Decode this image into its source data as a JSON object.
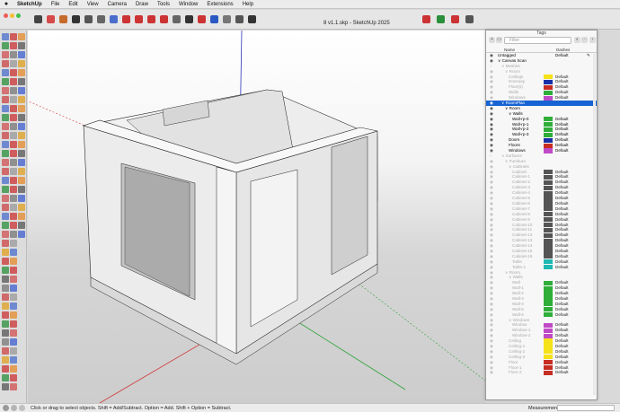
{
  "menubar": {
    "apple": "",
    "items": [
      "SketchUp",
      "File",
      "Edit",
      "View",
      "Camera",
      "Draw",
      "Tools",
      "Window",
      "Extensions",
      "Help"
    ]
  },
  "window": {
    "title": "8 v1.1.skp - SketchUp 2025"
  },
  "status": {
    "hint": "Click or drag to select objects. Shift = Add/Subtract. Option = Add. Shift + Option = Subtract.",
    "measurements_label": "Measurements",
    "measurements_value": ""
  },
  "tags_panel": {
    "header": "Tags",
    "search_placeholder": "Filter",
    "col_name": "Name",
    "col_dashes": "Dashes",
    "rows": [
      {
        "label": "Untagged",
        "indent": 0,
        "dash": "Default",
        "swatch": "",
        "visible": true,
        "dim": false,
        "selected": false,
        "pencil": true
      },
      {
        "label": "Canvas Scan",
        "indent": 0,
        "dash": "",
        "swatch": "",
        "visible": true,
        "dim": false,
        "selected": false,
        "arrow": "∨"
      },
      {
        "label": "Meshes",
        "indent": 1,
        "dash": "",
        "swatch": "",
        "visible": false,
        "dim": true,
        "selected": false,
        "arrow": "∨"
      },
      {
        "label": "Room",
        "indent": 2,
        "dash": "",
        "swatch": "",
        "visible": true,
        "dim": true,
        "selected": false,
        "arrow": "∨"
      },
      {
        "label": "Ceilings",
        "indent": 3,
        "dash": "Default",
        "swatch": "#f5e21a",
        "visible": true,
        "dim": true,
        "selected": false
      },
      {
        "label": "Doorway",
        "indent": 3,
        "dash": "Default",
        "swatch": "#1730a8",
        "visible": true,
        "dim": true,
        "selected": false
      },
      {
        "label": "Floor(s)",
        "indent": 3,
        "dash": "Default",
        "swatch": "#c62d23",
        "visible": true,
        "dim": true,
        "selected": false
      },
      {
        "label": "Walls",
        "indent": 3,
        "dash": "Default",
        "swatch": "#2fae3a",
        "visible": true,
        "dim": true,
        "selected": false
      },
      {
        "label": "Windows",
        "indent": 3,
        "dash": "Default",
        "swatch": "#c04ac7",
        "visible": true,
        "dim": true,
        "selected": false
      },
      {
        "label": "RoomPlan",
        "indent": 1,
        "dash": "",
        "swatch": "",
        "visible": true,
        "dim": false,
        "selected": true,
        "arrow": "∨"
      },
      {
        "label": "Room",
        "indent": 2,
        "dash": "",
        "swatch": "",
        "visible": true,
        "dim": false,
        "selected": false,
        "arrow": "∨"
      },
      {
        "label": "Walls",
        "indent": 3,
        "dash": "",
        "swatch": "",
        "visible": true,
        "dim": false,
        "selected": false,
        "arrow": "∨"
      },
      {
        "label": "Wall-rp-0",
        "indent": 4,
        "dash": "Default",
        "swatch": "#2fae3a",
        "visible": true,
        "dim": false,
        "selected": false
      },
      {
        "label": "Wall-rp-1",
        "indent": 4,
        "dash": "Default",
        "swatch": "#2fae3a",
        "visible": true,
        "dim": false,
        "selected": false
      },
      {
        "label": "Wall-rp-2",
        "indent": 4,
        "dash": "Default",
        "swatch": "#2fae3a",
        "visible": true,
        "dim": false,
        "selected": false
      },
      {
        "label": "Wall-rp-3",
        "indent": 4,
        "dash": "Default",
        "swatch": "#2fae3a",
        "visible": true,
        "dim": false,
        "selected": false
      },
      {
        "label": "Doors",
        "indent": 3,
        "dash": "Default",
        "swatch": "#1730a8",
        "visible": true,
        "dim": false,
        "selected": false
      },
      {
        "label": "Floors",
        "indent": 3,
        "dash": "Default",
        "swatch": "#c62d23",
        "visible": true,
        "dim": false,
        "selected": false
      },
      {
        "label": "Windows",
        "indent": 3,
        "dash": "Default",
        "swatch": "#c04ac7",
        "visible": true,
        "dim": false,
        "selected": false
      },
      {
        "label": "Surfaces",
        "indent": 1,
        "dash": "",
        "swatch": "",
        "visible": false,
        "dim": true,
        "selected": false,
        "arrow": "∨"
      },
      {
        "label": "Furniture",
        "indent": 2,
        "dash": "",
        "swatch": "",
        "visible": true,
        "dim": true,
        "selected": false,
        "arrow": "∨"
      },
      {
        "label": "Cabinets",
        "indent": 3,
        "dash": "",
        "swatch": "",
        "visible": true,
        "dim": true,
        "selected": false,
        "arrow": "∨"
      },
      {
        "label": "Cabinet",
        "indent": 4,
        "dash": "Default",
        "swatch": "#555555",
        "visible": true,
        "dim": true,
        "selected": false
      },
      {
        "label": "Cabinet-1",
        "indent": 4,
        "dash": "Default",
        "swatch": "#555555",
        "visible": true,
        "dim": true,
        "selected": false
      },
      {
        "label": "Cabinet-2",
        "indent": 4,
        "dash": "Default",
        "swatch": "#555555",
        "visible": true,
        "dim": true,
        "selected": false
      },
      {
        "label": "Cabinet-3",
        "indent": 4,
        "dash": "Default",
        "swatch": "#555555",
        "visible": true,
        "dim": true,
        "selected": false
      },
      {
        "label": "Cabinet-4",
        "indent": 4,
        "dash": "Default",
        "swatch": "#555555",
        "visible": true,
        "dim": true,
        "selected": false
      },
      {
        "label": "Cabinet-5",
        "indent": 4,
        "dash": "Default",
        "swatch": "#555555",
        "visible": true,
        "dim": true,
        "selected": false
      },
      {
        "label": "Cabinet-6",
        "indent": 4,
        "dash": "Default",
        "swatch": "#555555",
        "visible": true,
        "dim": true,
        "selected": false
      },
      {
        "label": "Cabinet-7",
        "indent": 4,
        "dash": "Default",
        "swatch": "#555555",
        "visible": true,
        "dim": true,
        "selected": false
      },
      {
        "label": "Cabinet-8",
        "indent": 4,
        "dash": "Default",
        "swatch": "#555555",
        "visible": true,
        "dim": true,
        "selected": false
      },
      {
        "label": "Cabinet-9",
        "indent": 4,
        "dash": "Default",
        "swatch": "#555555",
        "visible": true,
        "dim": true,
        "selected": false
      },
      {
        "label": "Cabinet-10",
        "indent": 4,
        "dash": "Default",
        "swatch": "#555555",
        "visible": true,
        "dim": true,
        "selected": false
      },
      {
        "label": "Cabinet-11",
        "indent": 4,
        "dash": "Default",
        "swatch": "#555555",
        "visible": true,
        "dim": true,
        "selected": false
      },
      {
        "label": "Cabinet-12",
        "indent": 4,
        "dash": "Default",
        "swatch": "#555555",
        "visible": true,
        "dim": true,
        "selected": false
      },
      {
        "label": "Cabinet-13",
        "indent": 4,
        "dash": "Default",
        "swatch": "#555555",
        "visible": true,
        "dim": true,
        "selected": false
      },
      {
        "label": "Cabinet-14",
        "indent": 4,
        "dash": "Default",
        "swatch": "#555555",
        "visible": true,
        "dim": true,
        "selected": false
      },
      {
        "label": "Cabinet-15",
        "indent": 4,
        "dash": "Default",
        "swatch": "#555555",
        "visible": true,
        "dim": true,
        "selected": false
      },
      {
        "label": "Cabinet-16",
        "indent": 4,
        "dash": "Default",
        "swatch": "#555555",
        "visible": true,
        "dim": true,
        "selected": false
      },
      {
        "label": "Table",
        "indent": 4,
        "dash": "Default",
        "swatch": "#1fb8b3",
        "visible": true,
        "dim": true,
        "selected": false
      },
      {
        "label": "Table-1",
        "indent": 4,
        "dash": "Default",
        "swatch": "#1fb8b3",
        "visible": true,
        "dim": true,
        "selected": false
      },
      {
        "label": "Room",
        "indent": 2,
        "dash": "",
        "swatch": "",
        "visible": true,
        "dim": true,
        "selected": false,
        "arrow": "∨"
      },
      {
        "label": "Walls",
        "indent": 3,
        "dash": "",
        "swatch": "",
        "visible": true,
        "dim": true,
        "selected": false,
        "arrow": "∨"
      },
      {
        "label": "Wall",
        "indent": 4,
        "dash": "Default",
        "swatch": "#2fae3a",
        "visible": true,
        "dim": true,
        "selected": false
      },
      {
        "label": "Wall-1",
        "indent": 4,
        "dash": "Default",
        "swatch": "#2fae3a",
        "visible": true,
        "dim": true,
        "selected": false
      },
      {
        "label": "Wall-2",
        "indent": 4,
        "dash": "Default",
        "swatch": "#2fae3a",
        "visible": true,
        "dim": true,
        "selected": false
      },
      {
        "label": "Wall-3",
        "indent": 4,
        "dash": "Default",
        "swatch": "#2fae3a",
        "visible": true,
        "dim": true,
        "selected": false
      },
      {
        "label": "Wall-4",
        "indent": 4,
        "dash": "Default",
        "swatch": "#2fae3a",
        "visible": true,
        "dim": true,
        "selected": false
      },
      {
        "label": "Wall-5",
        "indent": 4,
        "dash": "Default",
        "swatch": "#2fae3a",
        "visible": true,
        "dim": true,
        "selected": false
      },
      {
        "label": "Wall-6",
        "indent": 4,
        "dash": "Default",
        "swatch": "#2fae3a",
        "visible": true,
        "dim": true,
        "selected": false
      },
      {
        "label": "Windows",
        "indent": 3,
        "dash": "",
        "swatch": "",
        "visible": true,
        "dim": true,
        "selected": false,
        "arrow": "∨"
      },
      {
        "label": "Window",
        "indent": 4,
        "dash": "Default",
        "swatch": "#c04ac7",
        "visible": true,
        "dim": true,
        "selected": false
      },
      {
        "label": "Window-1",
        "indent": 4,
        "dash": "Default",
        "swatch": "#c04ac7",
        "visible": true,
        "dim": true,
        "selected": false
      },
      {
        "label": "Window-2",
        "indent": 4,
        "dash": "Default",
        "swatch": "#c04ac7",
        "visible": true,
        "dim": true,
        "selected": false
      },
      {
        "label": "Ceiling",
        "indent": 3,
        "dash": "Default",
        "swatch": "#f5e21a",
        "visible": true,
        "dim": true,
        "selected": false
      },
      {
        "label": "Ceiling-1",
        "indent": 3,
        "dash": "Default",
        "swatch": "#f5e21a",
        "visible": true,
        "dim": true,
        "selected": false
      },
      {
        "label": "Ceiling-2",
        "indent": 3,
        "dash": "Default",
        "swatch": "#f5e21a",
        "visible": true,
        "dim": true,
        "selected": false
      },
      {
        "label": "Ceiling-3",
        "indent": 3,
        "dash": "Default",
        "swatch": "#f5e21a",
        "visible": true,
        "dim": true,
        "selected": false
      },
      {
        "label": "Floor",
        "indent": 3,
        "dash": "Default",
        "swatch": "#c62d23",
        "visible": true,
        "dim": true,
        "selected": false
      },
      {
        "label": "Floor-1",
        "indent": 3,
        "dash": "Default",
        "swatch": "#c62d23",
        "visible": true,
        "dim": true,
        "selected": false
      },
      {
        "label": "Floor-2",
        "indent": 3,
        "dash": "Default",
        "swatch": "#c62d23",
        "visible": true,
        "dim": true,
        "selected": false
      }
    ]
  },
  "icons": {
    "toolbar": [
      "select-icon",
      "eraser-icon",
      "paint-icon",
      "line-icon",
      "arc-icon",
      "rectangle-icon",
      "pushpull-icon",
      "move-icon",
      "rotate-icon",
      "scale-icon",
      "offset-icon",
      "tape-icon",
      "text-icon",
      "axes-icon",
      "orbit-icon",
      "pan-icon",
      "zoom-icon",
      "zoom-extents-icon",
      "warehouse-icon",
      "extension-icon",
      "layout-icon",
      "tags-icon"
    ],
    "colors": {
      "accent": "#1763d3",
      "axis_red": "#d23c3c",
      "axis_green": "#2fa33a",
      "axis_blue": "#2b35b8"
    }
  }
}
